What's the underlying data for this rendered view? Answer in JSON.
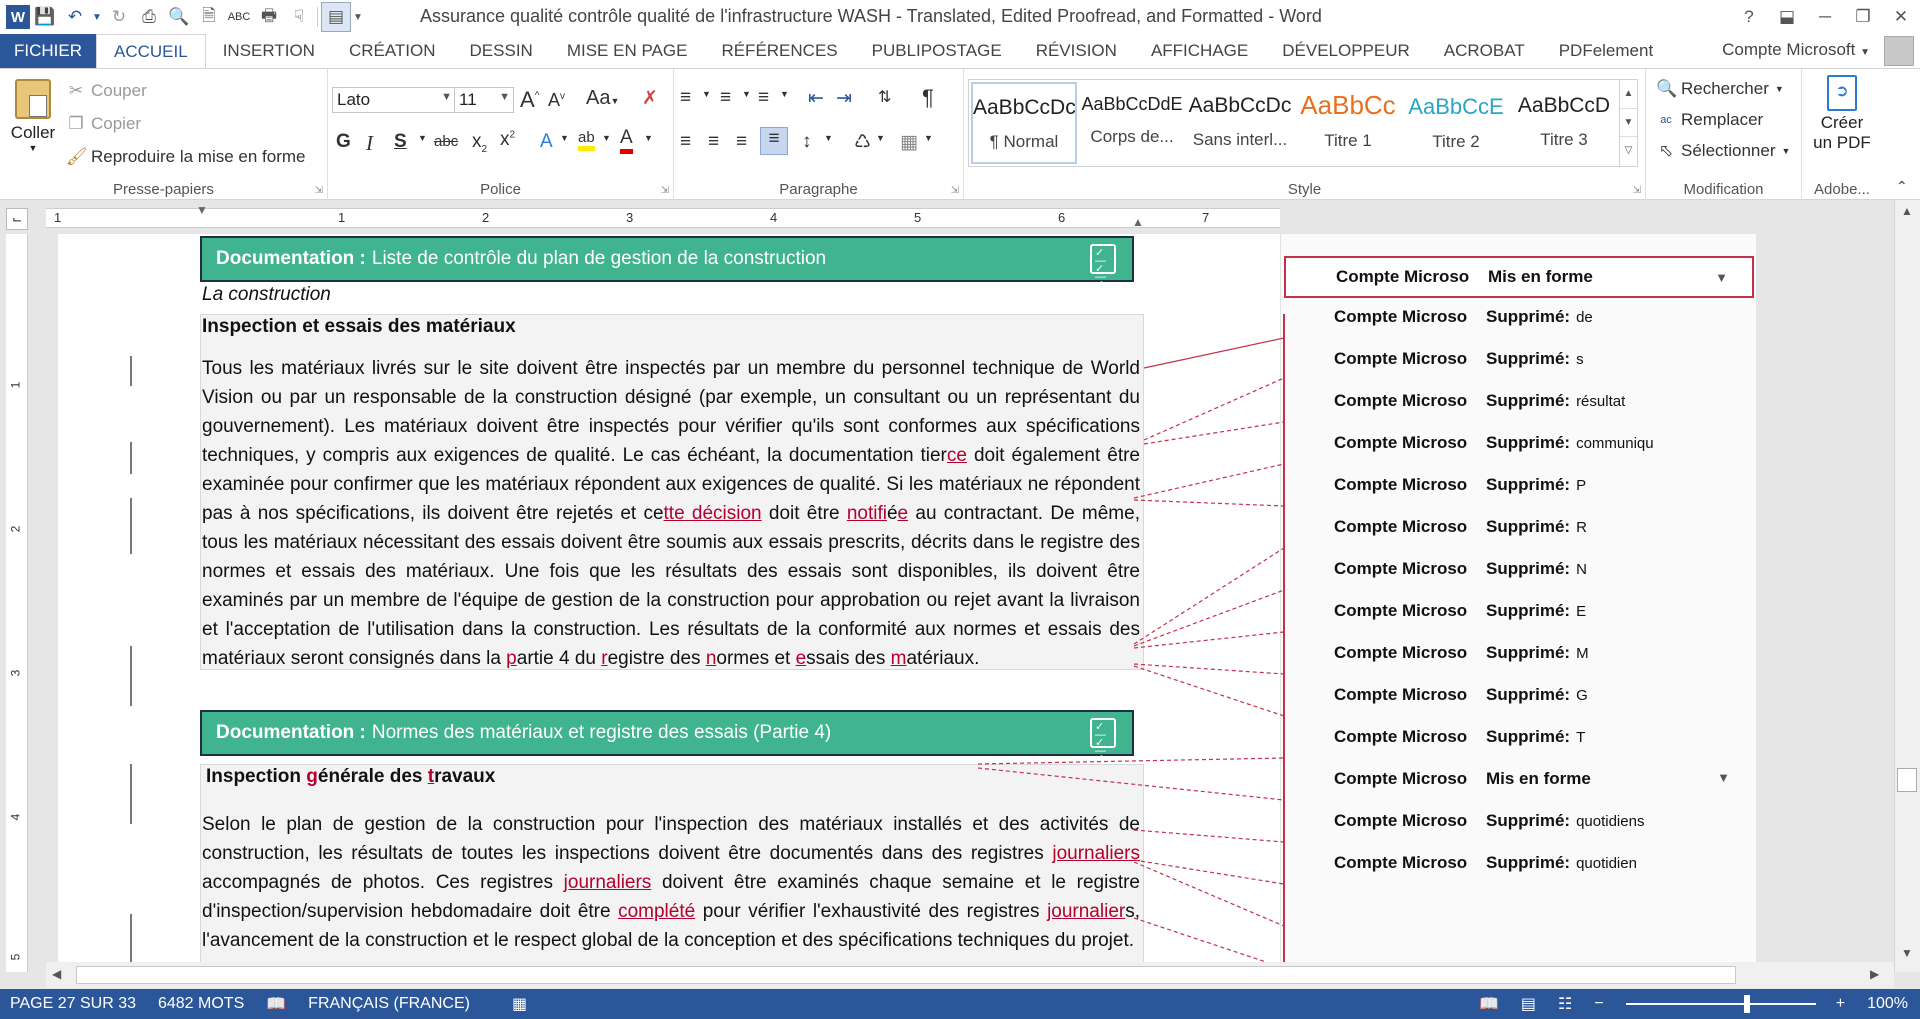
{
  "window": {
    "title": "Assurance qualité  contrôle qualité de l'infrastructure WASH - Translated, Edited Proofread, and Formatted - Word",
    "help": "?",
    "minimize": "─",
    "restore": "❐",
    "close": "✕"
  },
  "quick_access": [
    "word-logo-icon",
    "save-icon",
    "undo-icon",
    "redo-icon",
    "print-icon",
    "print-preview-icon",
    "new-document-icon",
    "spelling-icon",
    "quick-print-icon",
    "touch-mode-icon",
    "draft-view-icon"
  ],
  "tabs": [
    "FICHIER",
    "ACCUEIL",
    "INSERTION",
    "CRÉATION",
    "DESSIN",
    "MISE EN PAGE",
    "RÉFÉRENCES",
    "PUBLIPOSTAGE",
    "RÉVISION",
    "AFFICHAGE",
    "DÉVELOPPEUR",
    "ACROBAT",
    "PDFelement"
  ],
  "active_tab": "ACCUEIL",
  "account": "Compte Microsoft",
  "ribbon": {
    "clipboard": {
      "paste": "Coller",
      "cut": "Couper",
      "copy": "Copier",
      "format_painter": "Reproduire la mise en forme",
      "label": "Presse-papiers"
    },
    "font": {
      "family": "Lato",
      "size": "11",
      "label": "Police",
      "change_case": "Aa"
    },
    "paragraph": {
      "label": "Paragraphe"
    },
    "styles": {
      "label": "Style",
      "items": [
        {
          "sample": "AaBbCcDc",
          "name": "¶ Normal"
        },
        {
          "sample": "AaBbCcDdE",
          "name": "Corps de..."
        },
        {
          "sample": "AaBbCcDc",
          "name": "Sans interl..."
        },
        {
          "sample": "AaBbCc",
          "name": "Titre 1"
        },
        {
          "sample": "AaBbCcE",
          "name": "Titre 2"
        },
        {
          "sample": "AaBbCcD",
          "name": "Titre 3"
        }
      ]
    },
    "editing": {
      "find": "Rechercher",
      "replace": "Remplacer",
      "select": "Sélectionner",
      "label": "Modification"
    },
    "adobe": {
      "create_pdf_1": "Créer",
      "create_pdf_2": "un PDF",
      "label": "Adobe..."
    }
  },
  "ruler": {
    "h_numbers": [
      "1",
      "1",
      "2",
      "3",
      "4",
      "5",
      "6",
      "7"
    ],
    "v_numbers": [
      "1",
      "2",
      "3",
      "4",
      "5"
    ]
  },
  "document": {
    "banner1": {
      "bold": "Documentation :",
      "text": "Liste de contrôle du plan de gestion de la construction"
    },
    "subheading": "La construction",
    "heading1": "Inspection et essais des matériaux",
    "para1": [
      "Tous les matériaux livrés sur le site doivent être inspectés par un membre du personnel technique de World Vision ou par un responsable de la construction désigné (par exemple, un consultant ou un représentant du gouvernement). Les matériaux doivent être inspectés pour vérifier qu'ils sont conformes aux spécifications techniques, y compris aux exigences de qualité. Le cas échéant, la documentation tier",
      "ce",
      " doit également être examinée pour confirmer que les matériaux répondent aux exigences de qualité. Si les matériaux ne répondent pas à nos spécifications, ils doivent être rejetés et ce",
      "tte décision",
      " doit être ",
      "notifi",
      "é",
      "e",
      " au contractant. De même, tous les matériaux nécessitant des essais doivent être soumis aux essais prescrits, décrits dans le registre des normes et essais des matériaux. Une fois que les résultats des essais sont disponibles, ils doivent être examinés par un membre de l'équipe de gestion de la construction pour approbation ou rejet avant la livraison et l'acceptation de l'utilisation dans la construction. Les résultats de la conformité aux normes et essais des matériaux seront consignés dans la ",
      "p",
      "artie 4 du ",
      "r",
      "egistre des ",
      "n",
      "ormes et ",
      "e",
      "ssais des ",
      "m",
      "atériaux."
    ],
    "banner2": {
      "bold": "Documentation :",
      "text": "Normes des matériaux et registre des essais (Partie 4)"
    },
    "heading2": [
      "Inspection ",
      "g",
      "énérale des ",
      "t",
      "ravaux"
    ],
    "para2": [
      "Selon le plan de gestion de la construction pour l'inspection des matériaux installés et des activités de construction, les résultats de toutes les inspections doivent être documentés dans des registres ",
      "journaliers",
      " accompagnés de photos. Ces registres ",
      "journaliers",
      " doivent être examinés chaque semaine et le registre d'inspection/supervision hebdomadaire doit être ",
      "complété",
      " pour vérifier l'exhaustivité des registres ",
      "journalier",
      "s, l'avancement de la construction et le respect global de la conception et des spécifications techniques du projet."
    ]
  },
  "comments": [
    {
      "author": "Compte Microso",
      "action": "Mis en forme",
      "value": "",
      "type": "format"
    },
    {
      "author": "Compte Microso",
      "action": "Supprimé:",
      "value": "de",
      "type": "delete"
    },
    {
      "author": "Compte Microso",
      "action": "Supprimé:",
      "value": "s",
      "type": "delete"
    },
    {
      "author": "Compte Microso",
      "action": "Supprimé:",
      "value": "résultat",
      "type": "delete"
    },
    {
      "author": "Compte Microso",
      "action": "Supprimé:",
      "value": "communiqu",
      "type": "delete"
    },
    {
      "author": "Compte Microso",
      "action": "Supprimé:",
      "value": "P",
      "type": "delete"
    },
    {
      "author": "Compte Microso",
      "action": "Supprimé:",
      "value": "R",
      "type": "delete"
    },
    {
      "author": "Compte Microso",
      "action": "Supprimé:",
      "value": "N",
      "type": "delete"
    },
    {
      "author": "Compte Microso",
      "action": "Supprimé:",
      "value": "E",
      "type": "delete"
    },
    {
      "author": "Compte Microso",
      "action": "Supprimé:",
      "value": "M",
      "type": "delete"
    },
    {
      "author": "Compte Microso",
      "action": "Supprimé:",
      "value": "G",
      "type": "delete"
    },
    {
      "author": "Compte Microso",
      "action": "Supprimé:",
      "value": "T",
      "type": "delete"
    },
    {
      "author": "Compte Microso",
      "action": "Mis en forme",
      "value": "",
      "type": "format"
    },
    {
      "author": "Compte Microso",
      "action": "Supprimé:",
      "value": "quotidiens",
      "type": "delete"
    },
    {
      "author": "Compte Microso",
      "action": "Supprimé:",
      "value": "quotidien",
      "type": "delete"
    }
  ],
  "status": {
    "page": "PAGE 27 SUR 33",
    "words": "6482 MOTS",
    "language": "FRANÇAIS (FRANCE)",
    "zoom": "100%",
    "zoom_minus": "−",
    "zoom_plus": "+"
  },
  "colors": {
    "accent": "#2b579a",
    "banner": "#40b48e",
    "revision": "#b3002d"
  }
}
